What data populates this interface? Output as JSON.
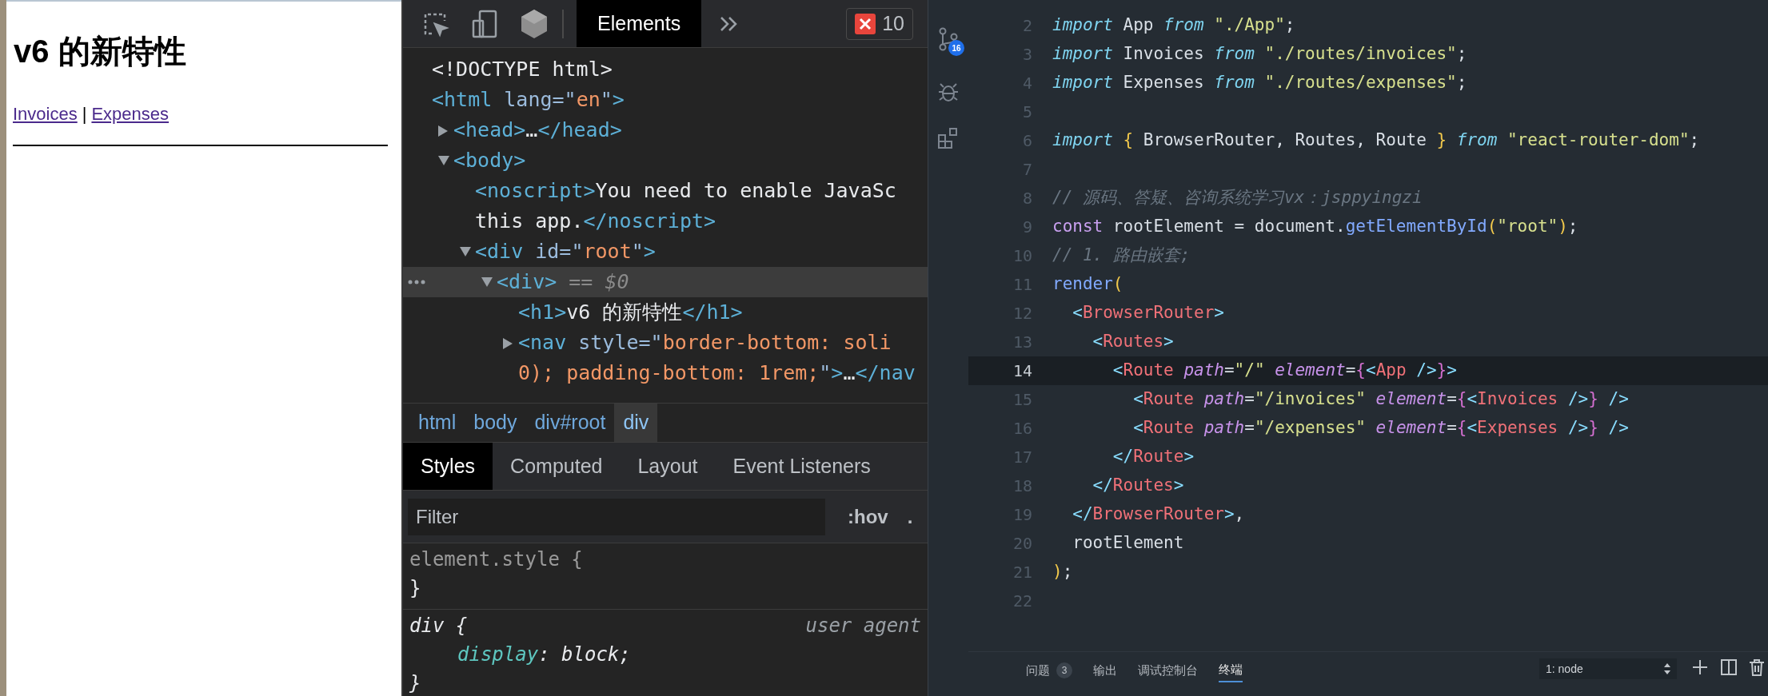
{
  "page": {
    "heading": "v6 的新特性",
    "links": [
      {
        "label": "Invoices"
      },
      {
        "label": "Expenses"
      }
    ],
    "separator": "|"
  },
  "devtools": {
    "tabs": [
      {
        "label": "Elements",
        "selected": true
      }
    ],
    "error_count": "10",
    "dom_tree": [
      {
        "kind": "plain",
        "selected": false,
        "lines": [
          [
            {
              "kind": "text",
              "text": "<!DOCTYPE html>"
            }
          ]
        ]
      },
      {
        "kind": "plain",
        "selected": false,
        "lines": [
          [
            {
              "kind": "tag",
              "text": "<html"
            },
            {
              "kind": "attr",
              "text": " lang=\""
            },
            {
              "kind": "val",
              "text": "en"
            },
            {
              "kind": "attr",
              "text": "\""
            },
            {
              "kind": "tag",
              "text": ">"
            }
          ]
        ],
        "children": [
          {
            "kind": "node",
            "expanded": false,
            "selected": false,
            "lines": [
              [
                {
                  "kind": "tag",
                  "text": "<head>"
                },
                {
                  "kind": "text",
                  "text": "…"
                },
                {
                  "kind": "tag",
                  "text": "</head>"
                }
              ]
            ]
          },
          {
            "kind": "node",
            "expanded": true,
            "selected": false,
            "lines": [
              [
                {
                  "kind": "tag",
                  "text": "<body>"
                }
              ]
            ],
            "children": [
              {
                "kind": "plain",
                "selected": false,
                "lines": [
                  [
                    {
                      "kind": "tag",
                      "text": "<noscript>"
                    },
                    {
                      "kind": "text",
                      "text": "You need to enable JavaSc"
                    }
                  ],
                  [
                    {
                      "kind": "text",
                      "text": "this app."
                    },
                    {
                      "kind": "tag",
                      "text": "</noscript>"
                    }
                  ]
                ]
              },
              {
                "kind": "node",
                "expanded": true,
                "selected": false,
                "lines": [
                  [
                    {
                      "kind": "tag",
                      "text": "<div"
                    },
                    {
                      "kind": "attr",
                      "text": " id=\""
                    },
                    {
                      "kind": "val",
                      "text": "root"
                    },
                    {
                      "kind": "attr",
                      "text": "\""
                    },
                    {
                      "kind": "tag",
                      "text": ">"
                    }
                  ]
                ],
                "children": [
                  {
                    "kind": "node",
                    "expanded": true,
                    "selected": true,
                    "lines": [
                      [
                        {
                          "kind": "tag",
                          "text": "<div>"
                        },
                        {
                          "kind": "mark",
                          "text": " == $0"
                        }
                      ]
                    ],
                    "children": [
                      {
                        "kind": "plain",
                        "selected": false,
                        "lines": [
                          [
                            {
                              "kind": "tag",
                              "text": "<h1>"
                            },
                            {
                              "kind": "text",
                              "text": "v6 的新特性"
                            },
                            {
                              "kind": "tag",
                              "text": "</h1>"
                            }
                          ]
                        ]
                      },
                      {
                        "kind": "node",
                        "expanded": false,
                        "selected": false,
                        "lines": [
                          [
                            {
                              "kind": "tag",
                              "text": "<nav"
                            },
                            {
                              "kind": "attr",
                              "text": " style=\""
                            },
                            {
                              "kind": "val",
                              "text": "border-bottom: soli"
                            }
                          ],
                          [
                            {
                              "kind": "val",
                              "text": "0); padding-bottom: 1rem;"
                            },
                            {
                              "kind": "attr",
                              "text": "\""
                            },
                            {
                              "kind": "tag",
                              "text": ">"
                            },
                            {
                              "kind": "text",
                              "text": "…"
                            },
                            {
                              "kind": "tag",
                              "text": "</nav"
                            }
                          ]
                        ]
                      }
                    ]
                  }
                ]
              }
            ]
          }
        ]
      }
    ],
    "breadcrumbs": [
      {
        "label": "html",
        "selected": false
      },
      {
        "label": "body",
        "selected": false
      },
      {
        "label": "div#root",
        "selected": false
      },
      {
        "label": "div",
        "selected": true
      }
    ],
    "style_tabs": [
      {
        "label": "Styles",
        "selected": true
      },
      {
        "label": "Computed",
        "selected": false
      },
      {
        "label": "Layout",
        "selected": false
      },
      {
        "label": "Event Listeners",
        "selected": false
      }
    ],
    "filter": {
      "placeholder": "Filter"
    },
    "filter_buttons": [
      ":hov",
      "."
    ],
    "rules": [
      {
        "kind": "inline",
        "selector": "element.style {",
        "close": "}"
      },
      {
        "kind": "user_agent",
        "selector": "div {",
        "source": "user agent",
        "declarations": [
          [
            {
              "kind": "prop",
              "text": "display"
            },
            {
              "kind": "plain",
              "text": ": block;"
            }
          ]
        ],
        "close": "}"
      }
    ]
  },
  "editor": {
    "source_control_count": "16",
    "lines": [
      {
        "number": "2",
        "current": false,
        "tokens": [
          {
            "kind": "kw",
            "text": "import"
          },
          {
            "kind": "p",
            "text": " App "
          },
          {
            "kind": "kw",
            "text": "from"
          },
          {
            "kind": "s",
            "text": " \"./App\""
          },
          {
            "kind": "p",
            "text": ";"
          }
        ]
      },
      {
        "number": "3",
        "current": false,
        "tokens": [
          {
            "kind": "kw",
            "text": "import"
          },
          {
            "kind": "p",
            "text": " Invoices "
          },
          {
            "kind": "kw",
            "text": "from"
          },
          {
            "kind": "s",
            "text": " \"./routes/invoices\""
          },
          {
            "kind": "p",
            "text": ";"
          }
        ]
      },
      {
        "number": "4",
        "current": false,
        "tokens": [
          {
            "kind": "kw",
            "text": "import"
          },
          {
            "kind": "p",
            "text": " Expenses "
          },
          {
            "kind": "kw",
            "text": "from"
          },
          {
            "kind": "s",
            "text": " \"./routes/expenses\""
          },
          {
            "kind": "p",
            "text": ";"
          }
        ]
      },
      {
        "number": "5",
        "current": false
      },
      {
        "number": "6",
        "current": false,
        "tokens": [
          {
            "kind": "kw",
            "text": "import"
          },
          {
            "kind": "b",
            "text": " {"
          },
          {
            "kind": "p",
            "text": " BrowserRouter, Routes, Route "
          },
          {
            "kind": "b",
            "text": "}"
          },
          {
            "kind": "kw",
            "text": " from"
          },
          {
            "kind": "s",
            "text": " \"react-router-dom\""
          },
          {
            "kind": "p",
            "text": ";"
          }
        ]
      },
      {
        "number": "7",
        "current": false
      },
      {
        "number": "8",
        "current": false,
        "tokens": [
          {
            "kind": "c",
            "text": "// 源码、答疑、咨询系统学习vx：jsppyingzi"
          }
        ]
      },
      {
        "number": "9",
        "current": false,
        "tokens": [
          {
            "kind": "st",
            "text": "const"
          },
          {
            "kind": "p",
            "text": " rootElement = document."
          },
          {
            "kind": "fn",
            "text": "getElementById"
          },
          {
            "kind": "b",
            "text": "("
          },
          {
            "kind": "s",
            "text": "\"root\""
          },
          {
            "kind": "b",
            "text": ")"
          },
          {
            "kind": "p",
            "text": ";"
          }
        ]
      },
      {
        "number": "10",
        "current": false,
        "tokens": [
          {
            "kind": "c",
            "text": "// 1. 路由嵌套;"
          }
        ]
      },
      {
        "number": "11",
        "current": false,
        "tokens": [
          {
            "kind": "fn",
            "text": "render"
          },
          {
            "kind": "b",
            "text": "("
          }
        ]
      },
      {
        "number": "12",
        "current": false,
        "tokens": [
          {
            "kind": "tb",
            "text": "  <"
          },
          {
            "kind": "tag",
            "text": "BrowserRouter"
          },
          {
            "kind": "tb",
            "text": ">"
          }
        ]
      },
      {
        "number": "13",
        "current": false,
        "tokens": [
          {
            "kind": "tb",
            "text": "    <"
          },
          {
            "kind": "tag",
            "text": "Routes"
          },
          {
            "kind": "tb",
            "text": ">"
          }
        ]
      },
      {
        "number": "14",
        "current": true,
        "tokens": [
          {
            "kind": "tb",
            "text": "      <"
          },
          {
            "kind": "tag",
            "text": "Route"
          },
          {
            "kind": "at",
            "text": " path"
          },
          {
            "kind": "p",
            "text": "="
          },
          {
            "kind": "s",
            "text": "\"/\""
          },
          {
            "kind": "at",
            "text": " element"
          },
          {
            "kind": "p",
            "text": "="
          },
          {
            "kind": "jb",
            "text": "{"
          },
          {
            "kind": "tb",
            "text": "<"
          },
          {
            "kind": "tag",
            "text": "App"
          },
          {
            "kind": "tb",
            "text": " />"
          },
          {
            "kind": "jb",
            "text": "}"
          },
          {
            "kind": "tb",
            "text": ">"
          }
        ]
      },
      {
        "number": "15",
        "current": false,
        "tokens": [
          {
            "kind": "tb",
            "text": "        <"
          },
          {
            "kind": "tag",
            "text": "Route"
          },
          {
            "kind": "at",
            "text": " path"
          },
          {
            "kind": "p",
            "text": "="
          },
          {
            "kind": "s",
            "text": "\"/invoices\""
          },
          {
            "kind": "at",
            "text": " element"
          },
          {
            "kind": "p",
            "text": "="
          },
          {
            "kind": "jb",
            "text": "{"
          },
          {
            "kind": "tb",
            "text": "<"
          },
          {
            "kind": "tag",
            "text": "Invoices"
          },
          {
            "kind": "tb",
            "text": " />"
          },
          {
            "kind": "jb",
            "text": "}"
          },
          {
            "kind": "tb",
            "text": " />"
          }
        ]
      },
      {
        "number": "16",
        "current": false,
        "tokens": [
          {
            "kind": "tb",
            "text": "        <"
          },
          {
            "kind": "tag",
            "text": "Route"
          },
          {
            "kind": "at",
            "text": " path"
          },
          {
            "kind": "p",
            "text": "="
          },
          {
            "kind": "s",
            "text": "\"/expenses\""
          },
          {
            "kind": "at",
            "text": " element"
          },
          {
            "kind": "p",
            "text": "="
          },
          {
            "kind": "jb",
            "text": "{"
          },
          {
            "kind": "tb",
            "text": "<"
          },
          {
            "kind": "tag",
            "text": "Expenses"
          },
          {
            "kind": "tb",
            "text": " />"
          },
          {
            "kind": "jb",
            "text": "}"
          },
          {
            "kind": "tb",
            "text": " />"
          }
        ]
      },
      {
        "number": "17",
        "current": false,
        "tokens": [
          {
            "kind": "tb",
            "text": "      </"
          },
          {
            "kind": "tag",
            "text": "Route"
          },
          {
            "kind": "tb",
            "text": ">"
          }
        ]
      },
      {
        "number": "18",
        "current": false,
        "tokens": [
          {
            "kind": "tb",
            "text": "    </"
          },
          {
            "kind": "tag",
            "text": "Routes"
          },
          {
            "kind": "tb",
            "text": ">"
          }
        ]
      },
      {
        "number": "19",
        "current": false,
        "tokens": [
          {
            "kind": "tb",
            "text": "  </"
          },
          {
            "kind": "tag",
            "text": "BrowserRouter"
          },
          {
            "kind": "tb",
            "text": ">"
          },
          {
            "kind": "p",
            "text": ","
          }
        ]
      },
      {
        "number": "20",
        "current": false,
        "tokens": [
          {
            "kind": "p",
            "text": "  rootElement"
          }
        ]
      },
      {
        "number": "21",
        "current": false,
        "tokens": [
          {
            "kind": "b",
            "text": ")"
          },
          {
            "kind": "p",
            "text": ";"
          }
        ]
      },
      {
        "number": "22",
        "current": false
      }
    ],
    "panel_tabs": [
      {
        "label": "问题",
        "badge": "3",
        "selected": false
      },
      {
        "label": "输出",
        "selected": false
      },
      {
        "label": "调试控制台",
        "selected": false
      },
      {
        "label": "终端",
        "selected": true
      }
    ],
    "terminal_select": "1: node"
  }
}
